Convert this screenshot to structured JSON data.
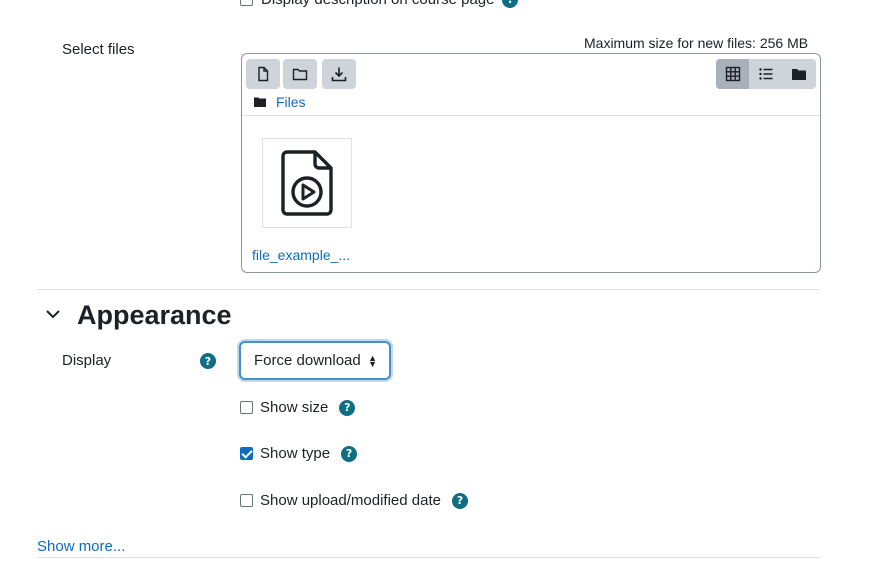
{
  "top": {
    "clipped_option_label": "Display description on course page"
  },
  "select_files": {
    "label": "Select files",
    "max_size": "Maximum size for new files: 256 MB",
    "path_label": "Files",
    "file_name": "file_example_..."
  },
  "appearance": {
    "title": "Appearance",
    "display_label": "Display",
    "display_value": "Force download",
    "options": [
      {
        "label": "Show size",
        "checked": false
      },
      {
        "label": "Show type",
        "checked": true
      },
      {
        "label": "Show upload/modified date",
        "checked": false
      }
    ]
  },
  "footer": {
    "show_more": "Show more..."
  },
  "colors": {
    "link": "#0f6cbf",
    "help": "#0f6e84",
    "focus": "#4a90c8"
  }
}
